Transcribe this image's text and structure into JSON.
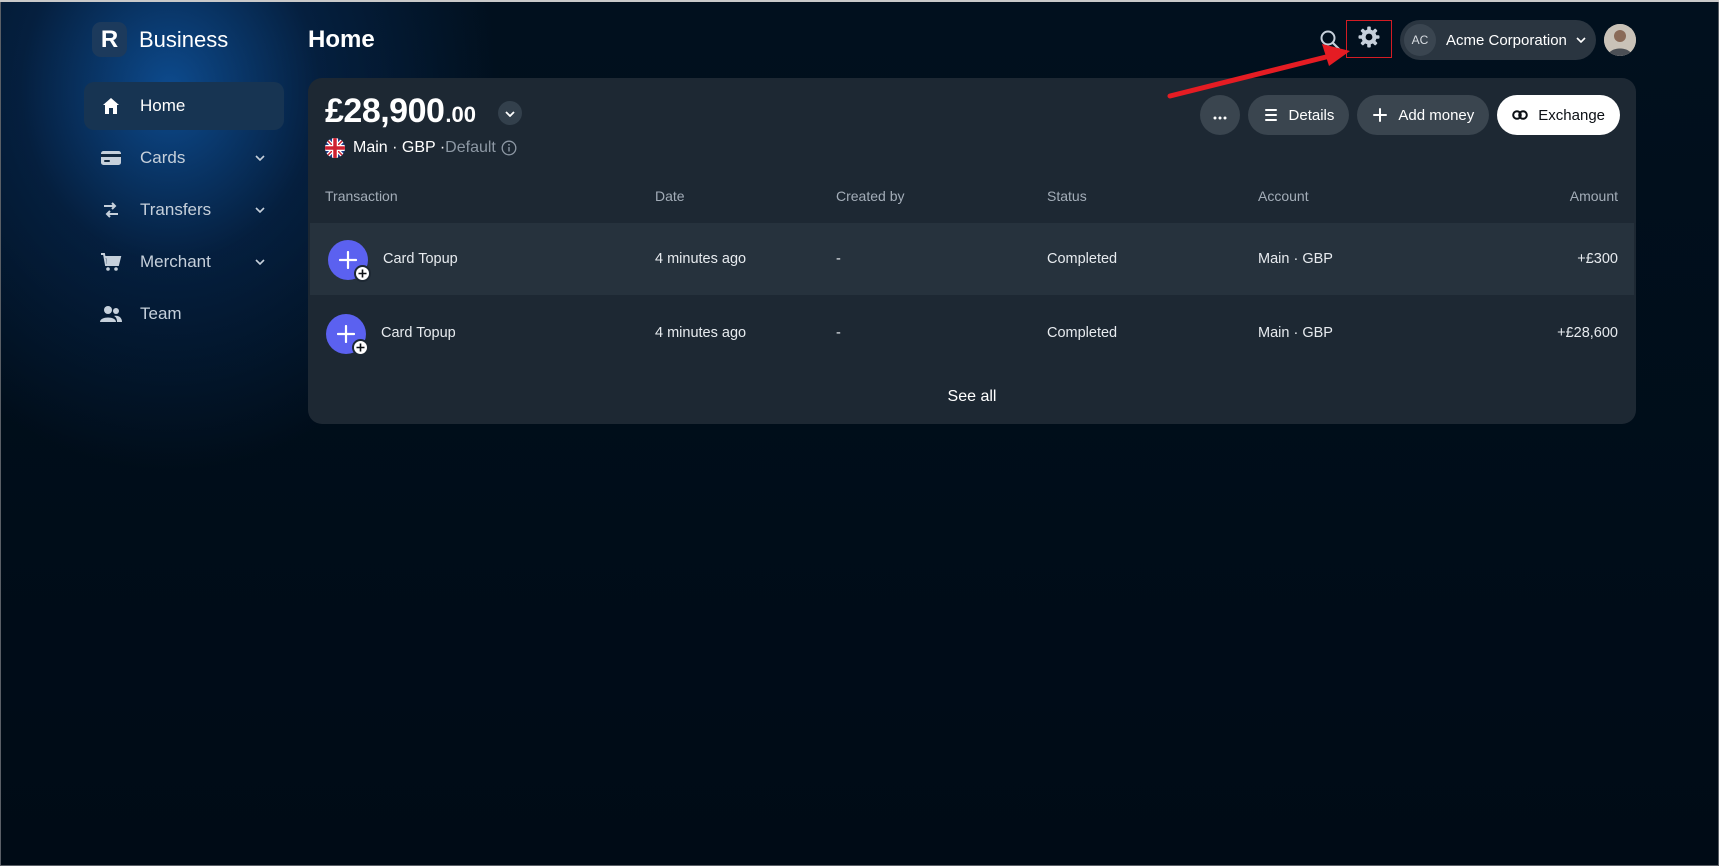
{
  "brand": {
    "logo_letter": "R",
    "name": "Business"
  },
  "sidebar": {
    "items": [
      {
        "label": "Home",
        "icon": "home-icon",
        "active": true
      },
      {
        "label": "Cards",
        "icon": "card-icon"
      },
      {
        "label": "Transfers",
        "icon": "transfers-icon"
      },
      {
        "label": "Merchant",
        "icon": "cart-icon"
      },
      {
        "label": "Team",
        "icon": "team-icon"
      }
    ]
  },
  "header": {
    "title": "Home",
    "account": {
      "initials": "AC",
      "name": "Acme Corporation"
    }
  },
  "balance": {
    "main": "£28,900",
    "cents": ".00",
    "account_name": "Main · GBP ·",
    "default_label": " Default"
  },
  "actions": {
    "details": "Details",
    "add_money": "Add money",
    "exchange": "Exchange"
  },
  "table": {
    "headers": [
      "Transaction",
      "Date",
      "Created by",
      "Status",
      "Account",
      "Amount"
    ],
    "rows": [
      {
        "name": "Card Topup",
        "date": "4 minutes ago",
        "created_by": "-",
        "status": "Completed",
        "account": "Main · GBP",
        "amount": "+£300"
      },
      {
        "name": "Card Topup",
        "date": "4 minutes ago",
        "created_by": "-",
        "status": "Completed",
        "account": "Main · GBP",
        "amount": "+£28,600"
      }
    ]
  },
  "see_all": "See all",
  "colors": {
    "accent_purple": "#5b61f0",
    "annotation_red": "#d41c24",
    "active_nav": "#173452"
  }
}
